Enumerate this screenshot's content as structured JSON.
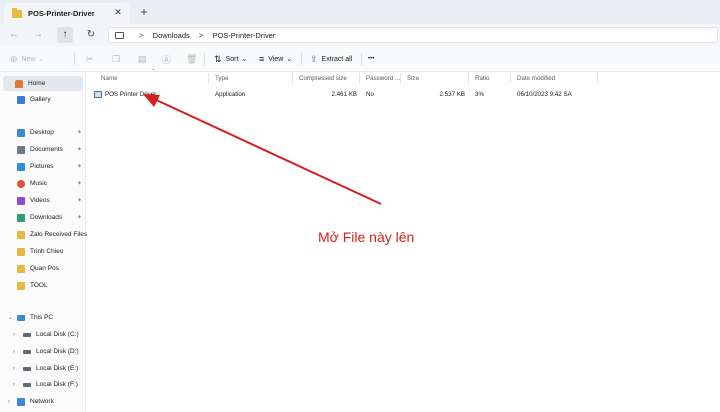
{
  "tabbar": {
    "tab_title": "POS-Printer-Driver",
    "close_glyph": "✕",
    "new_tab_glyph": "+"
  },
  "addressbar": {
    "back_glyph": "←",
    "forward_glyph": "→",
    "up_glyph": "↑",
    "refresh_glyph": "↻",
    "breadcrumb": [
      "Downloads",
      "POS-Printer-Driver"
    ],
    "separator": ">"
  },
  "commandbar": {
    "new_label": "New",
    "sort_label": "Sort",
    "view_label": "View",
    "extract_label": "Extract all",
    "more_glyph": "•••",
    "chevron": "⌄"
  },
  "sidebar": {
    "items": [
      {
        "label": "Home",
        "icon": "home-icon",
        "color": "#e0763a"
      },
      {
        "label": "Gallery",
        "icon": "gallery-icon",
        "color": "#3a7bd5"
      },
      {
        "label": "Desktop",
        "icon": "desktop-icon",
        "color": "#3a8ad8"
      },
      {
        "label": "Documents",
        "icon": "documents-icon",
        "color": "#6c7a8c"
      },
      {
        "label": "Pictures",
        "icon": "pictures-icon",
        "color": "#2f8fd6"
      },
      {
        "label": "Music",
        "icon": "music-icon",
        "color": "#e0553a"
      },
      {
        "label": "Videos",
        "icon": "videos-icon",
        "color": "#8a4fd1"
      },
      {
        "label": "Downloads",
        "icon": "downloads-icon",
        "color": "#2e9e6a"
      },
      {
        "label": "Zalo Received Files",
        "icon": "folder-icon",
        "color": "#e9b840"
      },
      {
        "label": "Trinh Chieu",
        "icon": "folder-icon",
        "color": "#e9b840"
      },
      {
        "label": "Quan Pos",
        "icon": "folder-icon",
        "color": "#e9b840"
      },
      {
        "label": "TOOL",
        "icon": "folder-icon",
        "color": "#e9b840"
      },
      {
        "label": "This PC",
        "icon": "pc-icon",
        "color": "#3a8ad8"
      },
      {
        "label": "Local Disk (C:)",
        "icon": "disk-icon",
        "color": "#606a75"
      },
      {
        "label": "Local Disk (D:)",
        "icon": "disk-icon",
        "color": "#606a75"
      },
      {
        "label": "Local Disk (E:)",
        "icon": "disk-icon",
        "color": "#606a75"
      },
      {
        "label": "Local Disk (F:)",
        "icon": "disk-icon",
        "color": "#606a75"
      },
      {
        "label": "Network",
        "icon": "network-icon",
        "color": "#3a8ad8"
      }
    ],
    "pin_glyph": "✦",
    "expand_glyph": "›"
  },
  "table": {
    "columns": [
      "Name",
      "Type",
      "Compressed size",
      "Password ...",
      "Size",
      "Ratio",
      "Date modified"
    ],
    "rows": [
      {
        "name": "POS Printer Driver",
        "type": "Application",
        "compressed": "2.461 KB",
        "password": "No",
        "size": "2.537 KB",
        "ratio": "3%",
        "date": "06/10/2023 9:42 SA"
      }
    ]
  },
  "annotation": {
    "text": "Mở File này lên",
    "color": "#d6201d"
  }
}
